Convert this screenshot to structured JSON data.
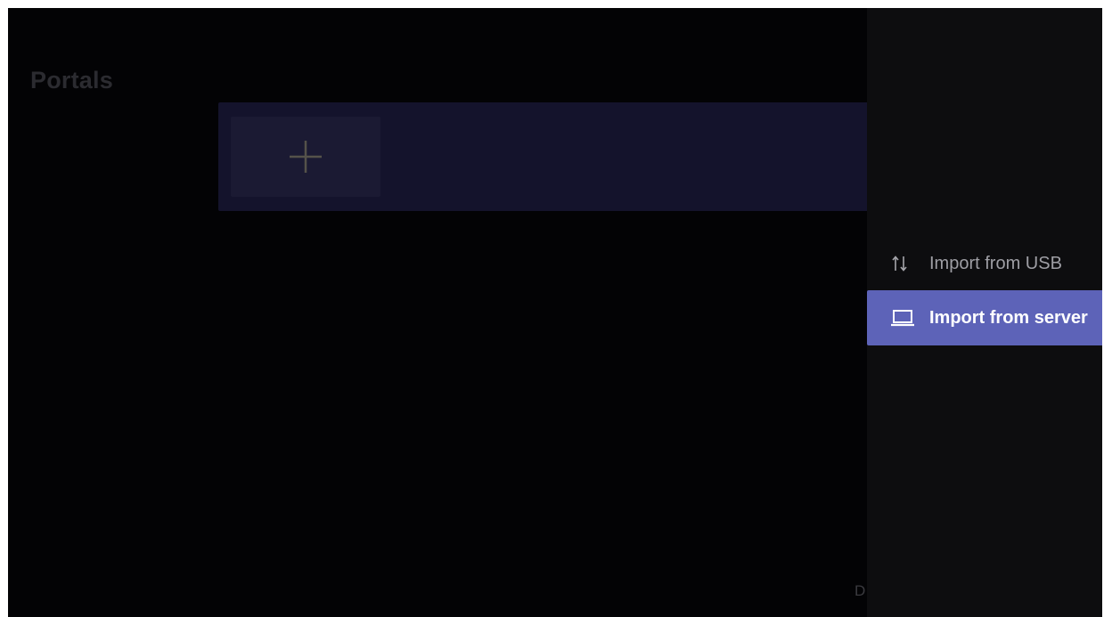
{
  "page": {
    "title": "Portals",
    "bottom_hint": "D"
  },
  "portals": {
    "add_tile_icon": "plus-icon"
  },
  "menu": {
    "items": [
      {
        "label": "Import from USB",
        "icon": "import-usb-icon",
        "selected": false
      },
      {
        "label": "Import from server",
        "icon": "laptop-icon",
        "selected": true
      }
    ]
  },
  "colors": {
    "background": "#030305",
    "portal_strip": "#14132c",
    "side_panel": "#0d0d0f",
    "selected_item": "#5d63b8"
  }
}
